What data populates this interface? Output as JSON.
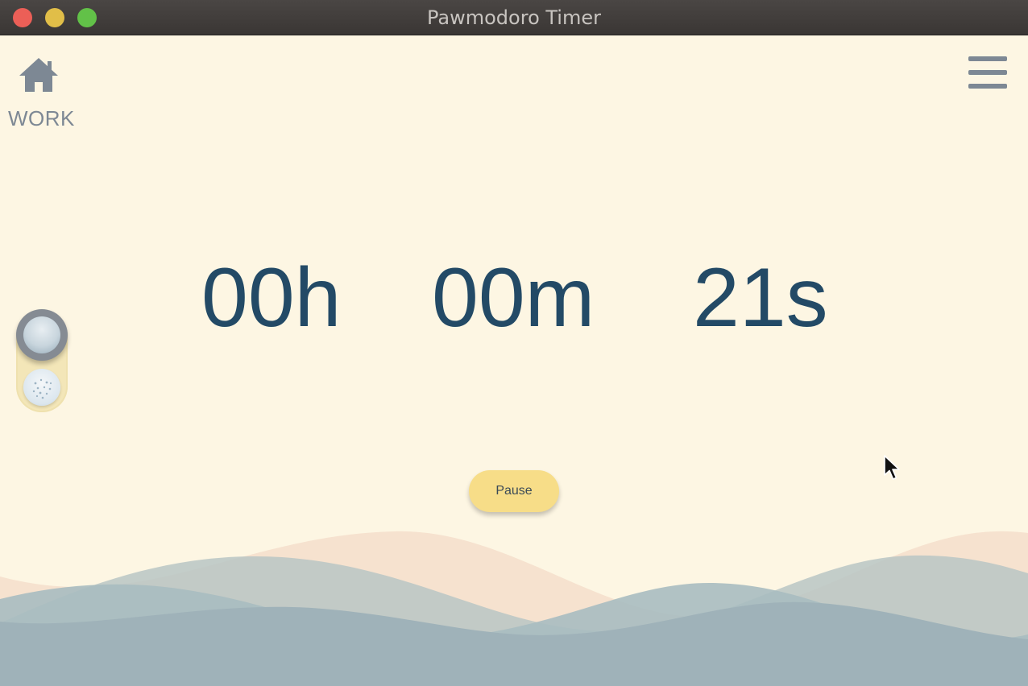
{
  "window": {
    "title": "Pawmodoro Timer"
  },
  "header": {
    "home_icon": "home-icon",
    "mode_label": "WORK",
    "menu_icon": "hamburger-menu-icon"
  },
  "toggle": {
    "top_icon": "water-bowl-icon",
    "bottom_icon": "food-bowl-icon",
    "selected": "top"
  },
  "timer": {
    "hours": "00h",
    "minutes": "00m",
    "seconds": "21s"
  },
  "controls": {
    "pause_label": "Pause"
  },
  "colors": {
    "background": "#fdf6e3",
    "timer_text": "#234a66",
    "icon_gray": "#7d8894",
    "button_yellow": "#f7dd88",
    "wave_peach": "#f6e2cf",
    "wave_blue": "#a2b5bb"
  }
}
